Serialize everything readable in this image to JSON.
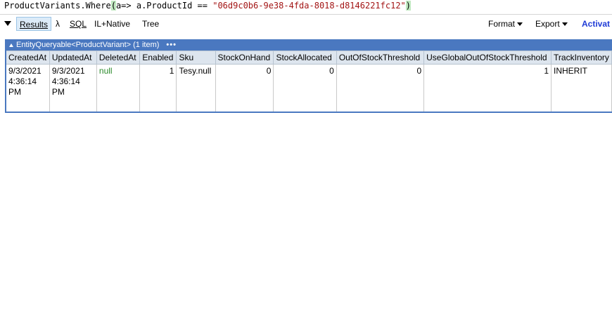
{
  "query": {
    "prefix": "ProductVariants.Where",
    "open_paren": "(",
    "lambda": "a=> a.ProductId == ",
    "string_literal": "\"06d9c0b6-9e38-4fda-8018-d8146221fc12\"",
    "close_paren": ")"
  },
  "toolbar": {
    "results": "Results",
    "lambda": "λ",
    "sql": "SQL",
    "il_native": "IL+Native",
    "tree": "Tree",
    "format": "Format",
    "export": "Export",
    "activate": "Activat"
  },
  "grid": {
    "header_title": "EntityQueryable<ProductVariant> (1 item)",
    "header_dots": "•••",
    "columns": [
      "CreatedAt",
      "UpdatedAt",
      "DeletedAt",
      "Enabled",
      "Sku",
      "StockOnHand",
      "StockAllocated",
      "OutOfStockThreshold",
      "UseGlobalOutOfStockThreshold",
      "TrackInventory"
    ],
    "row": {
      "created_at_date": "9/3/2021",
      "created_at_time": "4:36:14",
      "created_at_ampm": "PM",
      "updated_at_date": "9/3/2021",
      "updated_at_time": "4:36:14",
      "updated_at_ampm": "PM",
      "deleted_at": "null",
      "enabled": "1",
      "sku": "Tesy.null",
      "stock_on_hand": "0",
      "stock_allocated": "0",
      "out_of_stock_threshold": "0",
      "use_global": "1",
      "track_inventory": "INHERIT"
    }
  },
  "colors": {
    "grid_header": "#4a78c0",
    "null_value": "#2a8a2a",
    "string_literal": "#a31515",
    "activate": "#1f3bd6"
  }
}
